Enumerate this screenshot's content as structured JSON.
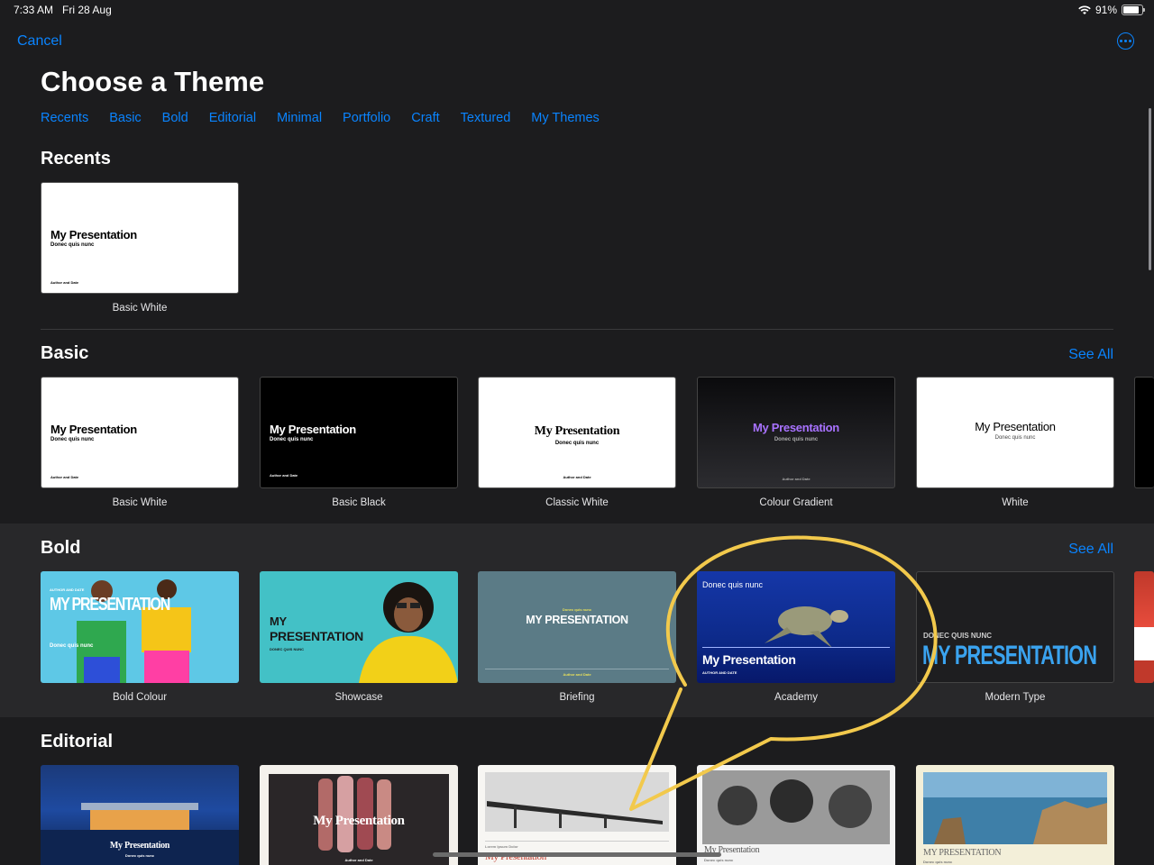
{
  "status": {
    "time": "7:33 AM",
    "date": "Fri 28 Aug",
    "battery": "91%"
  },
  "header": {
    "cancel": "Cancel",
    "title": "Choose a Theme",
    "more_icon": "ellipsis-circle-icon"
  },
  "tabs": [
    "Recents",
    "Basic",
    "Bold",
    "Editorial",
    "Minimal",
    "Portfolio",
    "Craft",
    "Textured",
    "My Themes"
  ],
  "see_all": "See All",
  "sections": {
    "recents": {
      "title": "Recents",
      "items": [
        "Basic White"
      ]
    },
    "basic": {
      "title": "Basic",
      "items": [
        "Basic White",
        "Basic Black",
        "Classic White",
        "Colour Gradient",
        "White"
      ]
    },
    "bold": {
      "title": "Bold",
      "items": [
        "Bold Colour",
        "Showcase",
        "Briefing",
        "Academy",
        "Modern Type"
      ]
    },
    "editorial": {
      "title": "Editorial"
    }
  },
  "thumb": {
    "my_presentation": "My Presentation",
    "donec": "Donec quis nunc",
    "author": "Author and Date",
    "upper_my": "MY PRESENTATION",
    "upper_donec": "DONEC QUIS NUNC",
    "upper_donec_short": "DONEC QUIS NUNC",
    "author_upper": "AUTHOR AND DATE",
    "my": "MY",
    "presentation": "PRESENTATION",
    "lorem": "Lorem Ipsum Dolor"
  },
  "colors": {
    "accent": "#0a84ff",
    "background": "#1c1c1e",
    "callout": "#f2c94c"
  }
}
